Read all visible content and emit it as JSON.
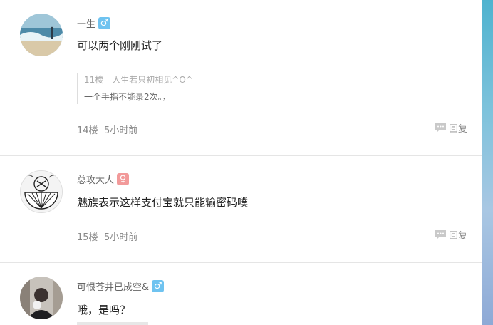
{
  "comments": [
    {
      "username": "一生",
      "gender": "♂",
      "text": "可以两个刚刚试了",
      "quote": {
        "floor": "11楼",
        "author": "人生若只初相见^O^",
        "text": "一个手指不能录2次。，"
      },
      "floor": "14楼",
      "time": "5小时前",
      "reply_label": "回复"
    },
    {
      "username": "总攻大人",
      "gender": "♀",
      "text": "魅族表示这样支付宝就只能输密码噗",
      "floor": "15楼",
      "time": "5小时前",
      "reply_label": "回复"
    },
    {
      "username": "可恨苍井已成空&",
      "gender": "♂",
      "text": "哦，是吗？"
    }
  ],
  "colors": {
    "male": "#6fc3f0",
    "female": "#f29a9a",
    "divider": "#e5e5e5"
  },
  "icons": {
    "reply": "speech-bubble-icon",
    "male": "male-symbol-icon",
    "female": "female-symbol-icon"
  }
}
